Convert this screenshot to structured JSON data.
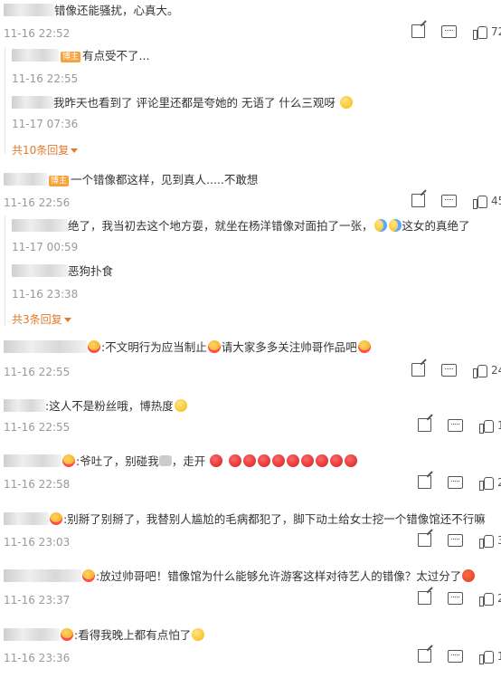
{
  "badge": "博主",
  "comments": [
    {
      "text": "错像还能骚扰，心真大。",
      "time": "11-16 22:52",
      "likes": "72"
    },
    {
      "text": "有点受不了...",
      "time": "11-16 22:55"
    },
    {
      "text": "我昨天也看到了 评论里还都是夸她的 无语了 什么三观呀",
      "time": "11-17 07:36"
    },
    {
      "more": "共10条回复"
    },
    {
      "text": "一个错像都这样，见到真人.....不敢想",
      "time": "11-16 22:56",
      "likes": "45"
    },
    {
      "text": "绝了，我当初去这个地方耍，就坐在杨洋错像对面拍了一张，",
      "text2": "这女的真绝了",
      "time": "11-17 00:59"
    },
    {
      "text": "恶狗扑食",
      "time": "11-16 23:38"
    },
    {
      "more": "共3条回复"
    },
    {
      "text": ":不文明行为应当制止",
      "text2": "请大家多多关注帅哥作品吧",
      "time": "11-16 22:55",
      "likes": "24"
    },
    {
      "text": ":这人不是粉丝哦，博热度",
      "time": "11-16 22:55",
      "likes": "1"
    },
    {
      "text": ":爷吐了，别碰我",
      "text2": "，走开",
      "time": "11-16 22:58",
      "likes": "2"
    },
    {
      "text": ":别掰了别掰了，我替别人尴尬的毛病都犯了，脚下动土给女士挖一个错像馆还不行嘛",
      "time": "11-16 23:03",
      "likes": "3"
    },
    {
      "text": ":放过帅哥吧！错像馆为什么能够允许游客这样对待艺人的错像？太过分了",
      "time": "11-16 23:37",
      "likes": "2"
    },
    {
      "text": ":看得我晚上都有点怕了",
      "time": "11-16 23:36",
      "likes": "1"
    }
  ]
}
